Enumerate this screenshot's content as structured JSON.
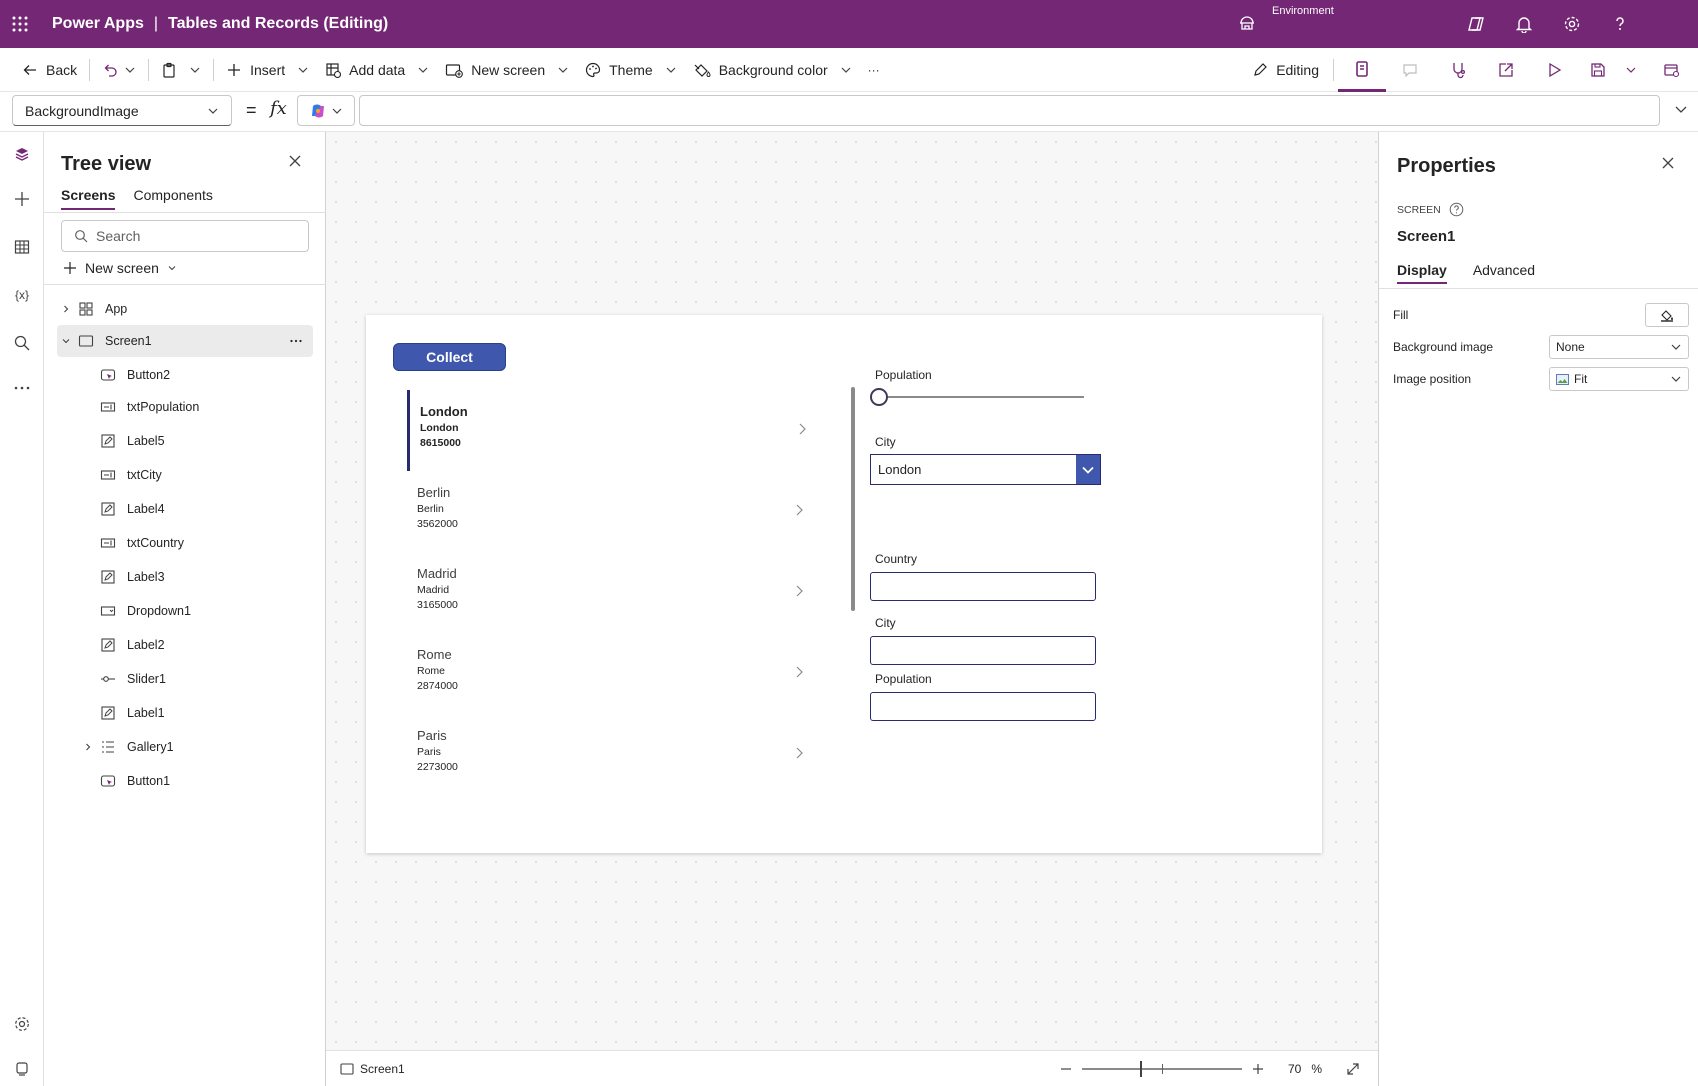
{
  "header": {
    "app_name": "Power Apps",
    "separator": "|",
    "doc_title": "Tables and Records (Editing)",
    "environment_label": "Environment"
  },
  "toolbar": {
    "back": "Back",
    "insert": "Insert",
    "add_data": "Add data",
    "new_screen": "New screen",
    "theme": "Theme",
    "background_color": "Background color",
    "more": "···",
    "editing": "Editing"
  },
  "formula": {
    "property": "BackgroundImage",
    "equals": "=",
    "fx": "fx",
    "value": ""
  },
  "tree": {
    "title": "Tree view",
    "tabs": [
      "Screens",
      "Components"
    ],
    "search_placeholder": "Search",
    "new_screen": "New screen",
    "items": [
      {
        "label": "App",
        "icon": "app-icon"
      },
      {
        "label": "Screen1",
        "icon": "screen-icon"
      },
      {
        "label": "Button2",
        "icon": "button-icon"
      },
      {
        "label": "txtPopulation",
        "icon": "text-input-icon"
      },
      {
        "label": "Label5",
        "icon": "label-icon"
      },
      {
        "label": "txtCity",
        "icon": "text-input-icon"
      },
      {
        "label": "Label4",
        "icon": "label-icon"
      },
      {
        "label": "txtCountry",
        "icon": "text-input-icon"
      },
      {
        "label": "Label3",
        "icon": "label-icon"
      },
      {
        "label": "Dropdown1",
        "icon": "dropdown-icon"
      },
      {
        "label": "Label2",
        "icon": "label-icon"
      },
      {
        "label": "Slider1",
        "icon": "slider-icon"
      },
      {
        "label": "Label1",
        "icon": "label-icon"
      },
      {
        "label": "Gallery1",
        "icon": "gallery-icon"
      },
      {
        "label": "Button1",
        "icon": "button-icon"
      }
    ]
  },
  "canvas": {
    "collect_label": "Collect",
    "gallery": [
      {
        "title": "London",
        "city": "London",
        "population": "8615000"
      },
      {
        "title": "Berlin",
        "city": "Berlin",
        "population": "3562000"
      },
      {
        "title": "Madrid",
        "city": "Madrid",
        "population": "3165000"
      },
      {
        "title": "Rome",
        "city": "Rome",
        "population": "2874000"
      },
      {
        "title": "Paris",
        "city": "Paris",
        "population": "2273000"
      }
    ],
    "population_label": "Population",
    "slider_value": 0,
    "city_label": "City",
    "dropdown_value": "London",
    "country_label": "Country",
    "city_label2": "City",
    "population_label2": "Population"
  },
  "status": {
    "screen_name": "Screen1",
    "zoom_value": "70",
    "zoom_unit": "%"
  },
  "properties": {
    "title": "Properties",
    "kind": "SCREEN",
    "name": "Screen1",
    "tabs": [
      "Display",
      "Advanced"
    ],
    "fill_label": "Fill",
    "bg_image_label": "Background image",
    "bg_image_value": "None",
    "img_pos_label": "Image position",
    "img_pos_value": "Fit"
  },
  "colors": {
    "brand": "#742774",
    "button": "#3f57ac",
    "accent_dark": "#2a2a6e"
  }
}
